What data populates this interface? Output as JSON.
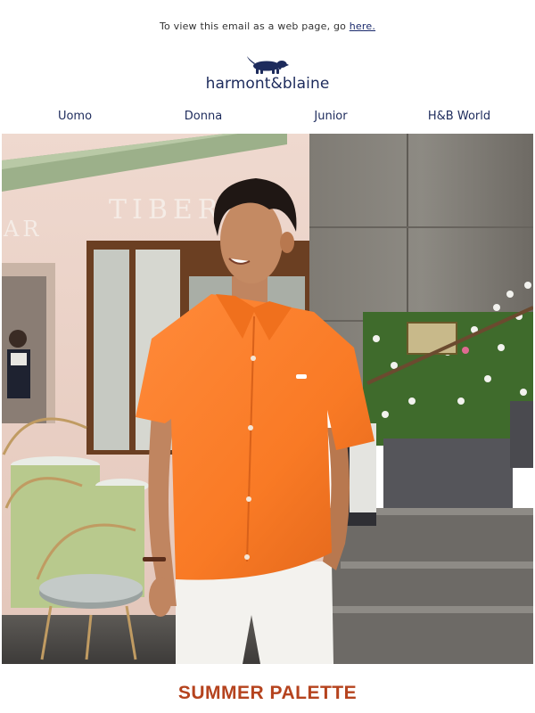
{
  "preheader": {
    "text": "To view this email as a web page, go ",
    "link": "here."
  },
  "brand": {
    "name": "harmont&blaine",
    "logo_icon": "dachshund-icon",
    "color": "#1d2b5c"
  },
  "nav": {
    "items": [
      {
        "label": "Uomo"
      },
      {
        "label": "Donna"
      },
      {
        "label": "Junior"
      },
      {
        "label": "H&B World"
      }
    ]
  },
  "hero": {
    "description": "man-in-orange-linen-shirt-at-cafe",
    "cafe_sign": "TIBERIO",
    "cafe_sign_left": "AR"
  },
  "headline": {
    "text": "SUMMER PALETTE",
    "color": "#b5431e"
  }
}
